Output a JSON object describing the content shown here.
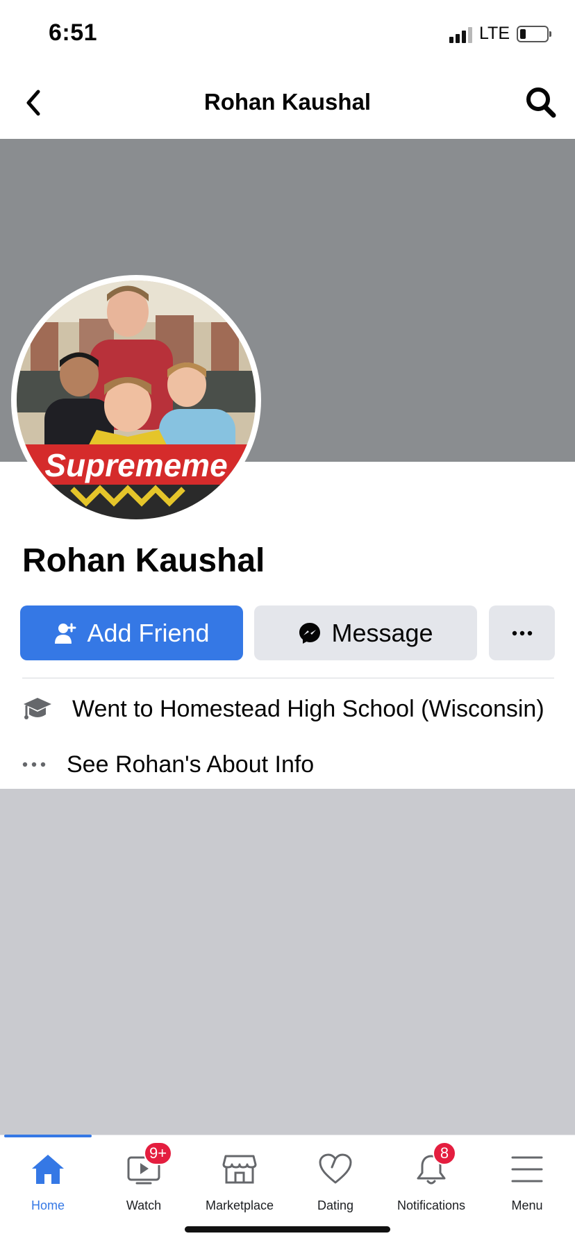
{
  "status_bar": {
    "time": "6:51",
    "network": "LTE"
  },
  "header": {
    "title": "Rohan Kaushal",
    "back_icon": "chevron-left-icon",
    "search_icon": "search-icon"
  },
  "profile": {
    "name": "Rohan Kaushal",
    "avatar_caption": "Suprememe"
  },
  "actions": {
    "add_friend_label": "Add Friend",
    "message_label": "Message",
    "more_icon": "ellipsis-icon"
  },
  "info": {
    "school": "Went to Homestead High School (Wisconsin)",
    "about_link": "See Rohan's About Info"
  },
  "tabbar": {
    "tabs": [
      {
        "label": "Home",
        "icon": "home-icon",
        "active": true
      },
      {
        "label": "Watch",
        "icon": "watch-icon",
        "badge": "9+"
      },
      {
        "label": "Marketplace",
        "icon": "marketplace-icon"
      },
      {
        "label": "Dating",
        "icon": "heart-icon"
      },
      {
        "label": "Notifications",
        "icon": "bell-icon",
        "badge": "8"
      },
      {
        "label": "Menu",
        "icon": "menu-icon"
      }
    ]
  },
  "colors": {
    "accent": "#3578e5",
    "badge": "#e41e3f",
    "cover": "#8a8d90",
    "feed_background": "#c9cacf"
  }
}
